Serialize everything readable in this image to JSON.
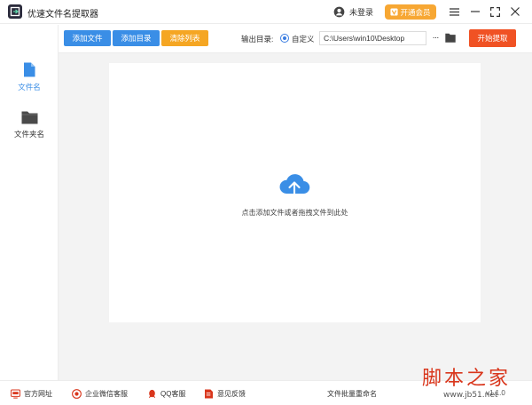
{
  "app": {
    "title": "优速文件名提取器"
  },
  "header": {
    "login_text": "未登录",
    "vip_label": "开通会员"
  },
  "toolbar": {
    "add_file": "添加文件",
    "add_dir": "添加目录",
    "clear_list": "清除列表",
    "output_label": "输出目录:",
    "custom_label": "自定义",
    "output_path": "C:\\Users\\win10\\Desktop",
    "more_label": "···",
    "start": "开始提取"
  },
  "sidebar": {
    "items": [
      {
        "label": "文件名"
      },
      {
        "label": "文件夹名"
      }
    ]
  },
  "main": {
    "drop_hint": "点击添加文件或者拖拽文件到此处"
  },
  "footer": {
    "website": "官方网址",
    "wechat_support": "企业微信客服",
    "qq_support": "QQ客服",
    "feedback": "意见反馈",
    "rename_link": "文件批量重命名",
    "version": "v1.1.0"
  },
  "watermark": {
    "text": "脚本之家",
    "url": "www.jb51.net"
  },
  "colors": {
    "blue": "#3a8ee6",
    "orange": "#f5a623",
    "red": "#f05224",
    "vip": "#f7a733"
  }
}
